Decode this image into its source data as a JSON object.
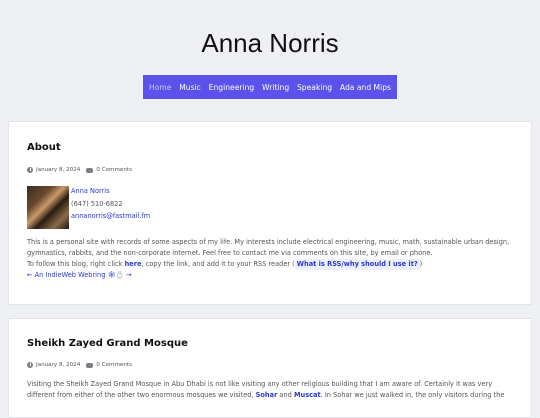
{
  "site": {
    "title": "Anna Norris"
  },
  "nav": {
    "items": [
      {
        "label": "Home",
        "active": true
      },
      {
        "label": "Music"
      },
      {
        "label": "Engineering"
      },
      {
        "label": "Writing"
      },
      {
        "label": "Speaking"
      },
      {
        "label": "Ada and Mips"
      }
    ]
  },
  "posts": [
    {
      "title": "About",
      "date": "January 8, 2024",
      "comments": "0 Comments",
      "contact": {
        "name": "Anna Norris",
        "phone": "(647) 510-6822",
        "email": "annanorris@fastmail.fm"
      },
      "para1_line1": "This is a personal site with records of some aspects of my life. My interests include electrical engineering, music, math, sustainable urban design,",
      "para1_line2": "gymnastics, rabbits, and the non-corporate internet. Feel free to contact me via comments on this site, by email or phone.",
      "follow_prefix": "To follow this blog, right click ",
      "follow_link": "here",
      "follow_mid": ", copy the link, and add it to your RSS reader (",
      "follow_rss": "What is RSS/why should I use it?",
      "follow_end": ")",
      "webring_prefix": "← An ",
      "webring_link": "IndieWeb Webring",
      "webring_suffix": " 🕸💍 →"
    },
    {
      "title": "Sheikh Zayed Grand Mosque",
      "date": "January 8, 2024",
      "comments": "0 Comments",
      "line1": "Visiting the Sheikh Zayed Grand Mosque in Abu Dhabi is not like visiting any other religious building that I am aware of. Certainly it was very",
      "line2_prefix": "different from either of the other two enormous mosques we visited, ",
      "line2_link1": "Sohar",
      "line2_and": " and ",
      "line2_link2": "Muscat",
      "line2_rest": ". In Sohar we just walked in, the only visitors during the"
    }
  ]
}
